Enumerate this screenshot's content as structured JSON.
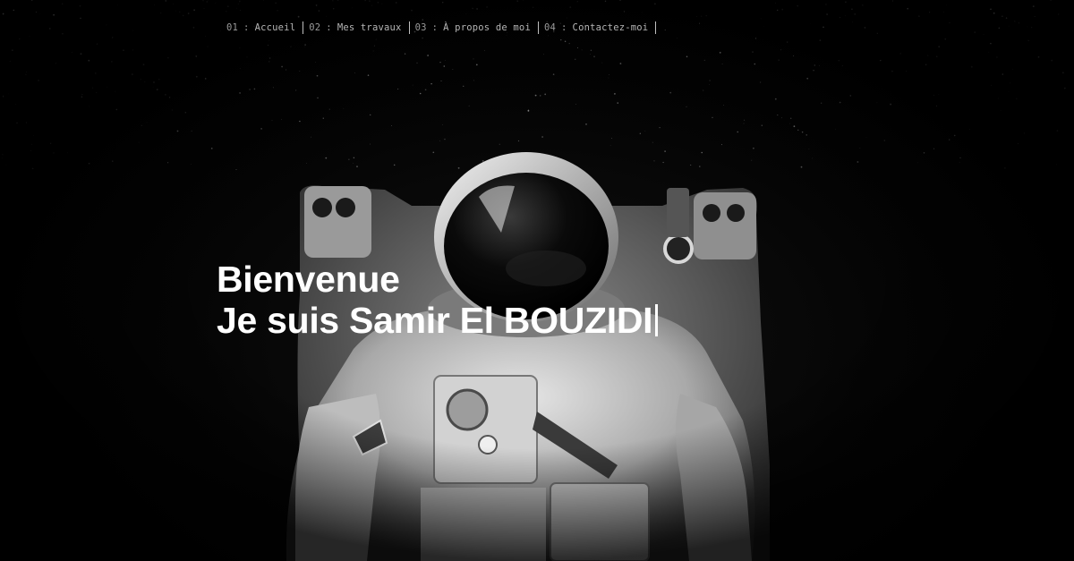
{
  "nav": {
    "items": [
      {
        "number": "01",
        "separator": ":",
        "label": "Accueil"
      },
      {
        "number": "02",
        "separator": ":",
        "label": "Mes travaux"
      },
      {
        "number": "03",
        "separator": ":",
        "label": "À propos de moi"
      },
      {
        "number": "04",
        "separator": ":",
        "label": "Contactez-moi"
      }
    ]
  },
  "hero": {
    "line1": "Bienvenue",
    "line2": "Je suis Samir El BOUZIDI",
    "background_image": "astronaut-in-space-photo"
  },
  "colors": {
    "background": "#000000",
    "headline": "#ffffff",
    "nav_text": "#9a9a9a",
    "nav_divider": "#bfbfbf"
  }
}
